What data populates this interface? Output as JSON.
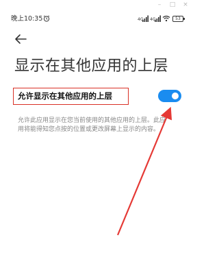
{
  "window": {
    "minimize_label": "–",
    "maximize_label": "□",
    "close_label": "×"
  },
  "status_bar": {
    "time": "晚上10:35",
    "battery_level": "53"
  },
  "icons": {
    "alarm": "alarm-icon",
    "signal": "signal-icon",
    "wifi": "wifi-icon",
    "back": "back-arrow-icon"
  },
  "page": {
    "title": "显示在其他应用的上层"
  },
  "setting": {
    "label": "允许显示在其他应用的上层",
    "enabled": true,
    "description": "允许此应用显示在您当前使用的其他应用的上层。此应用将能得知您点按的位置或更改屏幕上显示的内容。"
  },
  "colors": {
    "toggle_on": "#1a8cf0",
    "highlight_border": "#d93025",
    "arrow": "#e53935"
  }
}
